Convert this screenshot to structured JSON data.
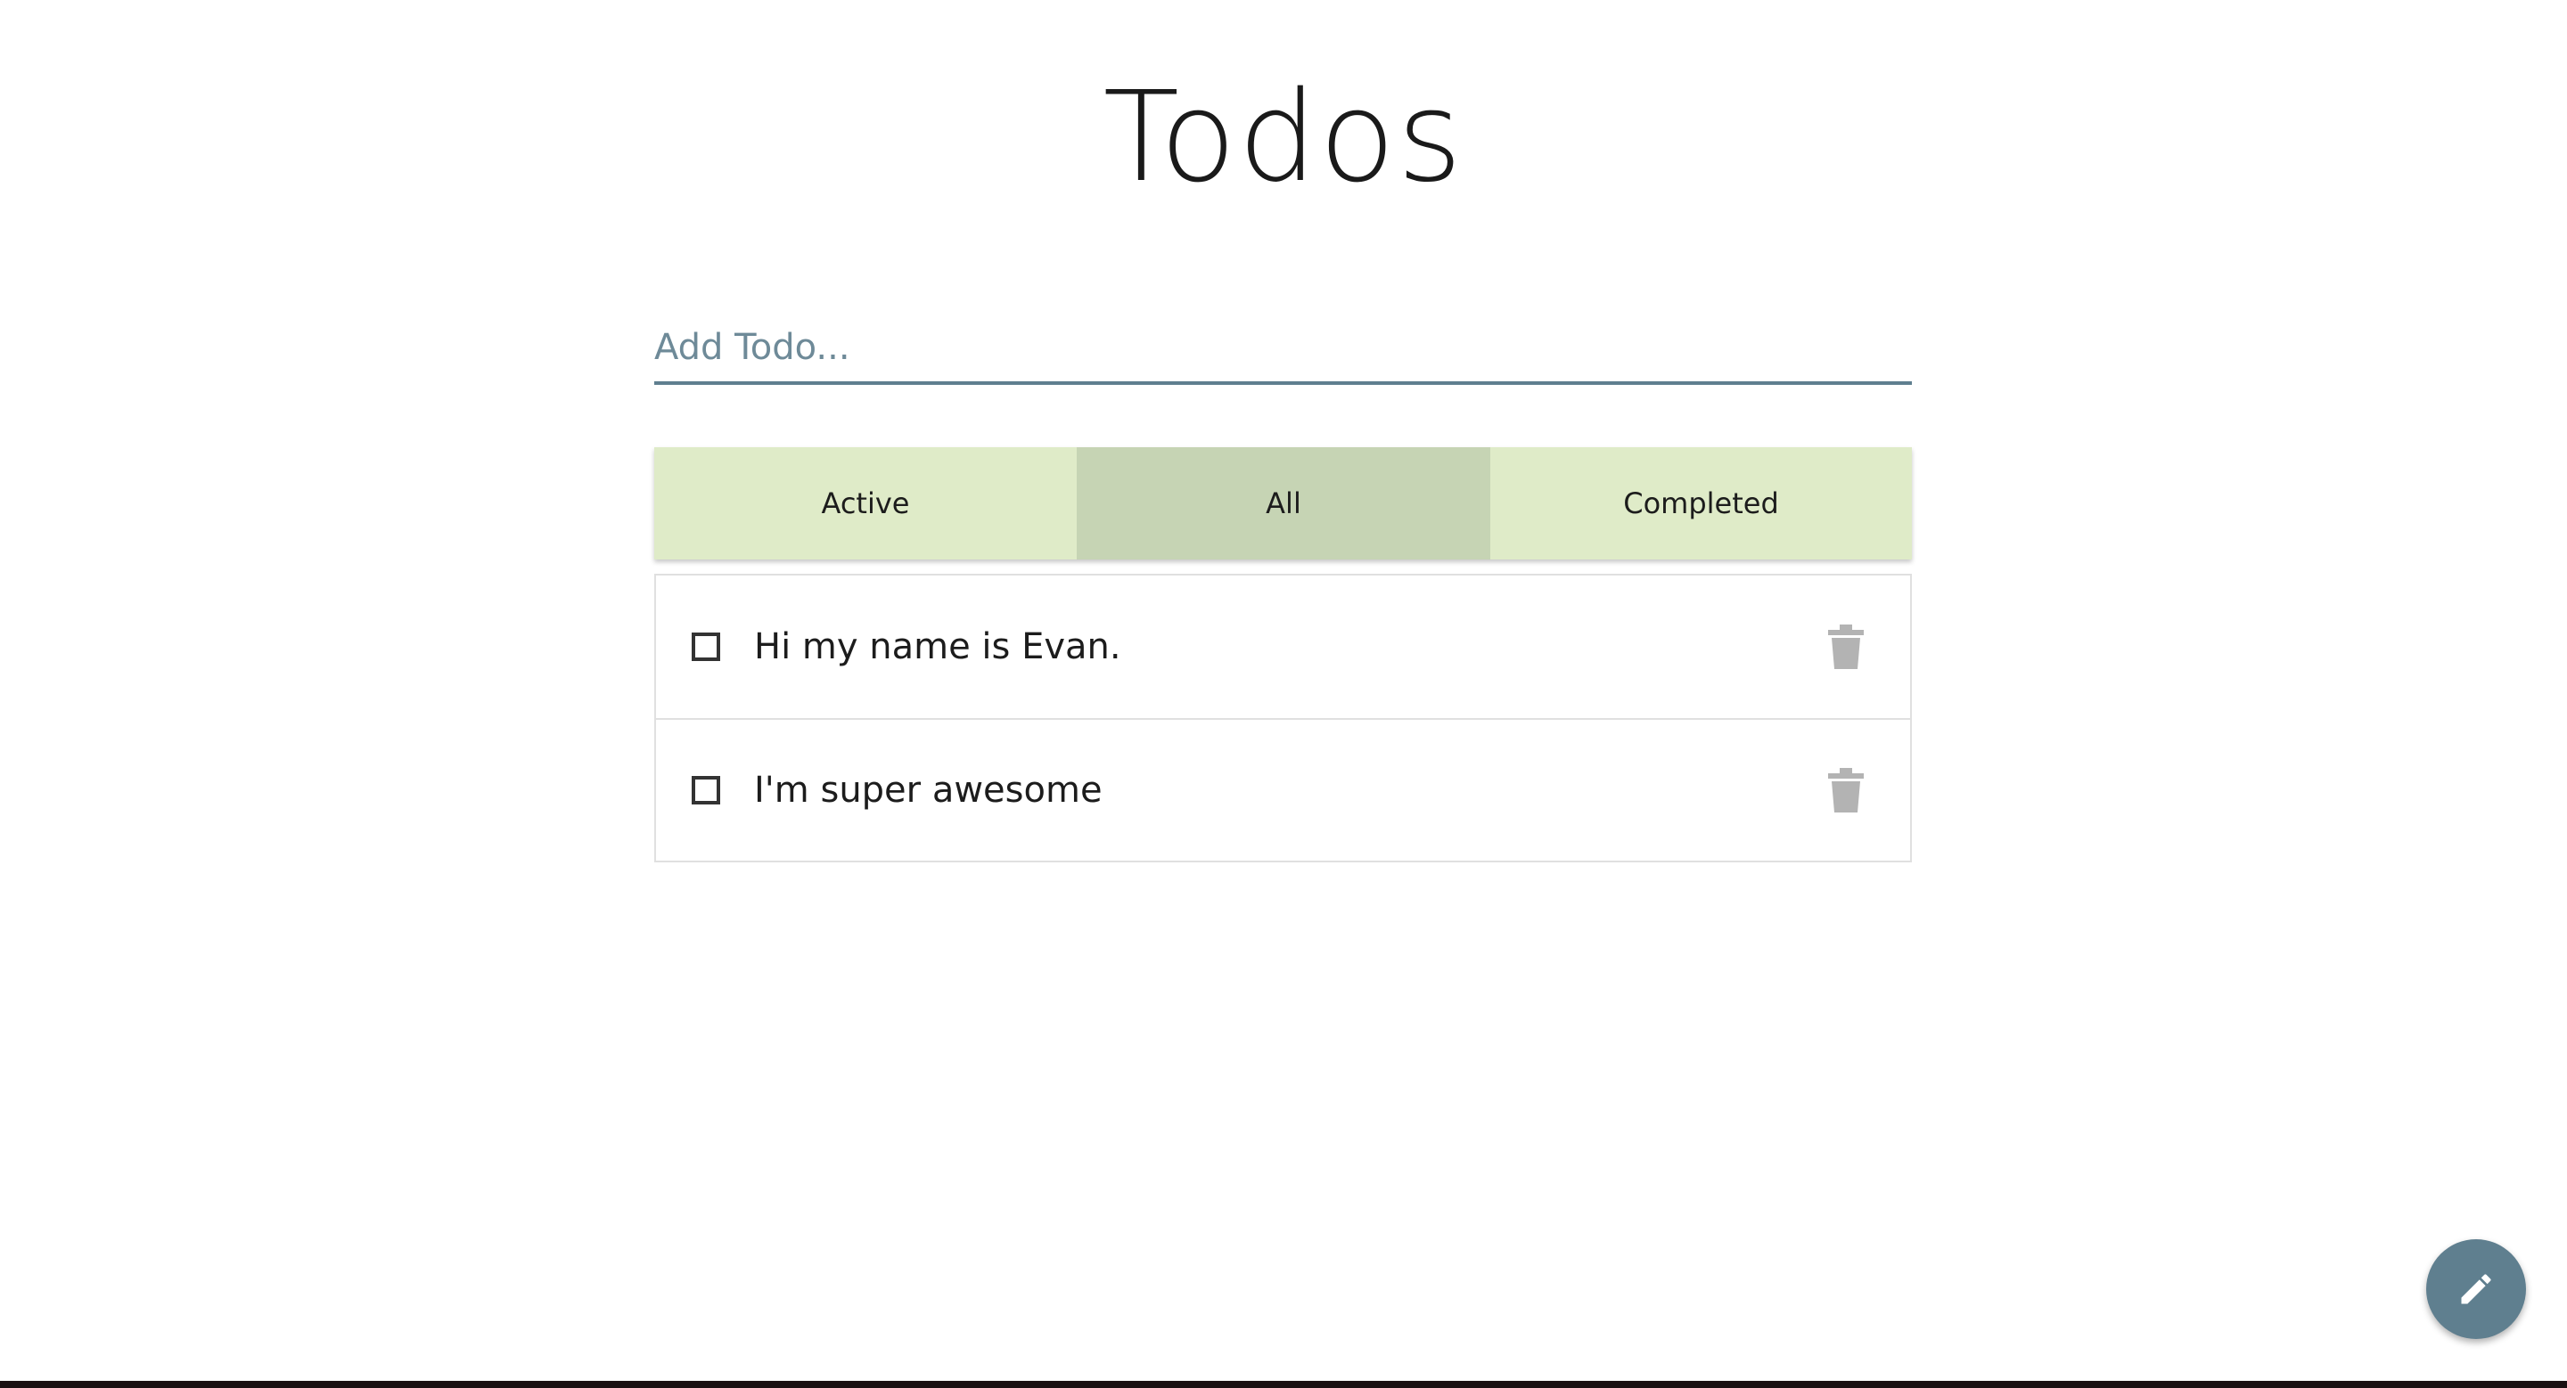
{
  "app": {
    "title": "Todos"
  },
  "add_todo": {
    "placeholder": "Add Todo..."
  },
  "filters": {
    "items": [
      {
        "label": "Active",
        "selected": false
      },
      {
        "label": "All",
        "selected": true
      },
      {
        "label": "Completed",
        "selected": false
      }
    ]
  },
  "todos": [
    {
      "text": "Hi my name is Evan.",
      "completed": false
    },
    {
      "text": "I'm super awesome",
      "completed": false
    }
  ],
  "icons": {
    "delete": "trash-icon",
    "fab": "pencil-icon"
  },
  "colors": {
    "accent": "#5f7f8f",
    "filter_bg": "#dfebc8",
    "filter_selected_bg": "#c6d4b4",
    "trash": "#b3b3b3"
  }
}
